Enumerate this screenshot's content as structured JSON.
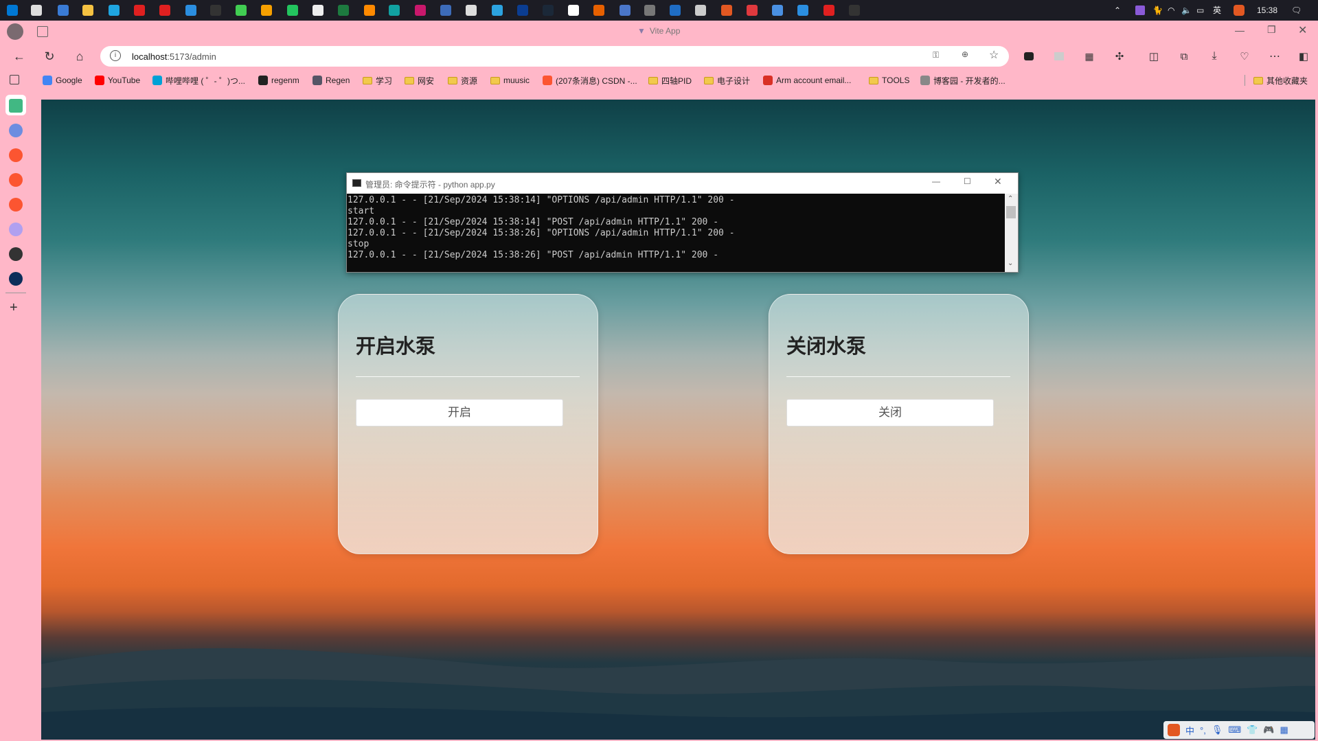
{
  "taskbar": {
    "icons": [
      "windows-start-icon",
      "search-icon",
      "desktop-icon",
      "file-explorer-icon",
      "edge-icon",
      "wps-icon",
      "xmind-icon",
      "vscode-icon",
      "intellij-icon",
      "qt-icon",
      "grid-app-icon",
      "wechat-icon",
      "notepad-icon",
      "excel-icon",
      "orange-app-icon",
      "arduino-icon",
      "rider-icon",
      "scissors-icon",
      "qq-icon",
      "telegram-icon",
      "terminal-icon",
      "steam-icon",
      "typora-icon",
      "firefox-icon",
      "browser-icon",
      "sublime-icon",
      "mx-icon",
      "nav-icon",
      "rocket-icon",
      "netease-music-icon",
      "photo-icon",
      "vscode-icon",
      "xmind-icon",
      "cmd-icon"
    ],
    "colors": [
      "#0078d4",
      "#ddd",
      "#3a7bd5",
      "#f5c242",
      "#1fa5e0",
      "#e02020",
      "#e02020",
      "#2b8ee0",
      "#333",
      "#41cd52",
      "#f7a000",
      "#23c45e",
      "#eee",
      "#1d7a3f",
      "#ff8a00",
      "#11a1a1",
      "#c9186c",
      "#3d6cb9",
      "#ddd",
      "#2ca3e0",
      "#0b3d91",
      "#1b2838",
      "#fff",
      "#e66000",
      "#4a76c9",
      "#777",
      "#1f6dc4",
      "#ccc",
      "#e25822",
      "#e0393e",
      "#4a90e2",
      "#2b8ee0",
      "#e02020",
      "#333"
    ],
    "tray_lang": "英",
    "clock": "15:38"
  },
  "browser": {
    "tab_title": "Vite App",
    "url_host": "localhost",
    "url_path": ":5173/admin",
    "bookmarks": [
      {
        "label": "Google",
        "icon": "google-icon",
        "color": "#4285f4"
      },
      {
        "label": "YouTube",
        "icon": "youtube-icon",
        "color": "#ff0000"
      },
      {
        "label": "哔哩哔哩 ( ゜- ゜)つ...",
        "icon": "bilibili-icon",
        "color": "#00a1d6"
      },
      {
        "label": "regenm",
        "icon": "github-icon",
        "color": "#222"
      },
      {
        "label": "Regen",
        "icon": "avatar-icon",
        "color": "#556"
      },
      {
        "label": "学习",
        "icon": "folder-icon",
        "color": ""
      },
      {
        "label": "网安",
        "icon": "folder-icon",
        "color": ""
      },
      {
        "label": "资源",
        "icon": "folder-icon",
        "color": ""
      },
      {
        "label": "muusic",
        "icon": "folder-icon",
        "color": ""
      },
      {
        "label": "(207条消息) CSDN -...",
        "icon": "csdn-icon",
        "color": "#fc5531"
      },
      {
        "label": "四轴PID",
        "icon": "folder-icon",
        "color": ""
      },
      {
        "label": "电子设计",
        "icon": "folder-icon",
        "color": ""
      },
      {
        "label": "Arm account email...",
        "icon": "gmail-icon",
        "color": "#d93025"
      },
      {
        "label": "TOOLS",
        "icon": "folder-icon",
        "color": ""
      },
      {
        "label": "博客园 - 开发者的...",
        "icon": "cnblogs-icon",
        "color": "#888"
      },
      {
        "label": "其他收藏夹",
        "icon": "folder-icon",
        "color": ""
      }
    ]
  },
  "sidebar": {
    "items": [
      {
        "icon": "vue-icon",
        "color": "#41b883"
      },
      {
        "icon": "edge-copilot-icon",
        "color": "#6c8de0"
      },
      {
        "icon": "csdn-icon",
        "color": "#fc5531"
      },
      {
        "icon": "csdn-icon",
        "color": "#fc5531"
      },
      {
        "icon": "csdn-icon",
        "color": "#fc5531"
      },
      {
        "icon": "purple-app-icon",
        "color": "#b0a0f0"
      },
      {
        "icon": "openai-icon",
        "color": "#333"
      },
      {
        "icon": "terminal-icon",
        "color": "#0c2d5a"
      }
    ]
  },
  "console": {
    "title": "管理员: 命令提示符 - python  app.py",
    "lines": [
      "127.0.0.1 - - [21/Sep/2024 15:38:14] \"OPTIONS /api/admin HTTP/1.1\" 200 -",
      "start",
      "127.0.0.1 - - [21/Sep/2024 15:38:14] \"POST /api/admin HTTP/1.1\" 200 -",
      "127.0.0.1 - - [21/Sep/2024 15:38:26] \"OPTIONS /api/admin HTTP/1.1\" 200 -",
      "stop",
      "127.0.0.1 - - [21/Sep/2024 15:38:26] \"POST /api/admin HTTP/1.1\" 200 -"
    ]
  },
  "page": {
    "cards": [
      {
        "title": "开启水泵",
        "button": "开启"
      },
      {
        "title": "关闭水泵",
        "button": "关闭"
      }
    ]
  }
}
